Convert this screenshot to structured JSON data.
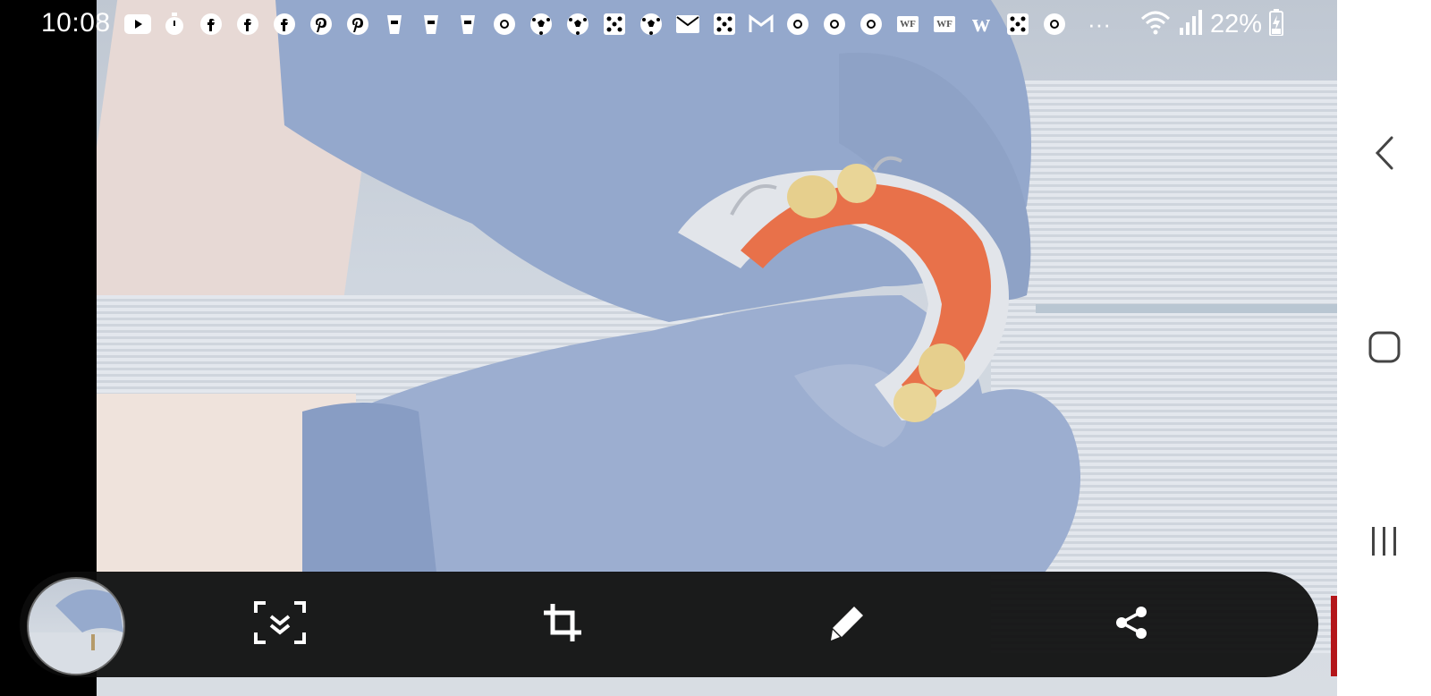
{
  "status_bar": {
    "time": "10:08",
    "battery_percent": "22%",
    "notification_icons": [
      "youtube-icon",
      "timer-icon",
      "facebook-icon",
      "facebook-icon",
      "facebook-icon",
      "pinterest-icon",
      "pinterest-icon",
      "cup-icon",
      "cup-icon",
      "cup-icon",
      "chrome-icon",
      "soccer-ball-icon",
      "soccer-ball-icon",
      "dice-icon",
      "soccer-ball-icon",
      "mail-icon",
      "dice-icon",
      "gmail-icon",
      "chrome-icon",
      "chrome-icon",
      "chrome-icon",
      "wf-icon",
      "wf-icon",
      "w-icon",
      "dice-icon",
      "chrome-icon"
    ],
    "wf_label": "WF",
    "w_label": "w",
    "overflow": "···"
  },
  "media": {
    "description_icon": "photo-frame",
    "colors": {
      "glove": "#9aaed3",
      "denture": "#e8714a",
      "sheet": "#dde2e8"
    }
  },
  "toolbar": {
    "buttons": [
      "scroll-capture-icon",
      "crop-icon",
      "edit-icon",
      "share-icon"
    ]
  },
  "nav": {
    "buttons": [
      "back-icon",
      "home-icon",
      "recents-icon"
    ]
  }
}
